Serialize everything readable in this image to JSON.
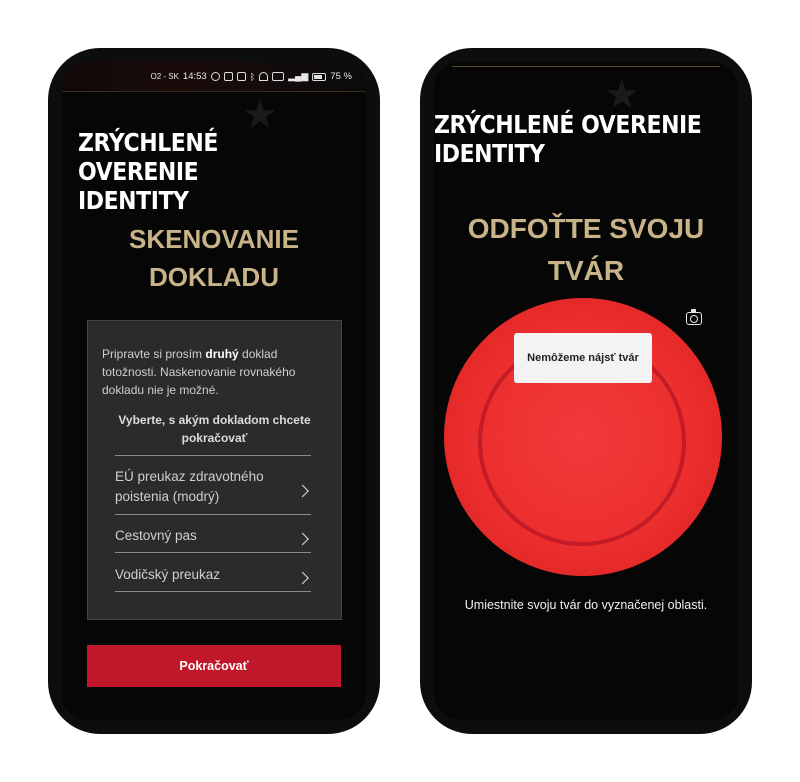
{
  "colors": {
    "accent_gold": "#c9b48a",
    "cta_red": "#c0182a",
    "face_red": "#ec2e2e",
    "background": "#060606"
  },
  "left_screen": {
    "status_bar": {
      "carrier": "O2 - SK",
      "time": "14:53",
      "battery": "75 %",
      "icons": [
        "eye-icon",
        "nfc-icon",
        "vibrate-icon",
        "bluetooth-icon",
        "wifi-icon",
        "volte-icon",
        "signal-icon",
        "battery-icon"
      ]
    },
    "brand_line1": "ZRÝCHLENÉ OVERENIE",
    "brand_line2": "IDENTITY",
    "heading_line1": "SKENOVANIE",
    "heading_line2": "DOKLADU",
    "card": {
      "intro_pre": "Pripravte si prosím ",
      "intro_bold": "druhý",
      "intro_post": " doklad totožnosti. Naskenovanie rovnakého dokladu nie je možné.",
      "prompt": "Vyberte, s akým dokladom chcete pokračovať",
      "options": [
        {
          "label": "EÚ preukaz zdravotného poistenia (modrý)"
        },
        {
          "label": "Cestovný pas"
        },
        {
          "label": "Vodičský preukaz"
        }
      ]
    },
    "continue_label": "Pokračovať"
  },
  "right_screen": {
    "brand_line1": "ZRÝCHLENÉ OVERENIE",
    "brand_line2": "IDENTITY",
    "heading_line1": "ODFOŤTE SVOJU",
    "heading_line2": "TVÁR",
    "face_tip": "Nemôžeme nájsť tvár",
    "camera_icon": "camera-switch-icon",
    "caption": "Umiestnite svoju tvár do vyznačenej oblasti."
  }
}
